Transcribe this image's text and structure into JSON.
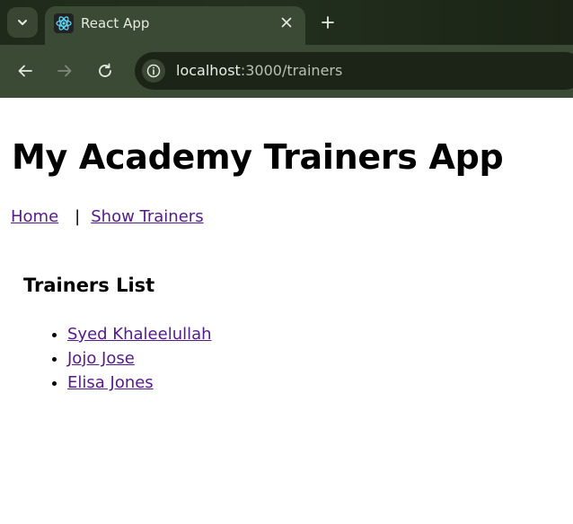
{
  "browser": {
    "tab_title": "React App",
    "url_host": "localhost",
    "url_path": ":3000/trainers",
    "colors": {
      "chrome_bg": "#1f2a1a",
      "tab_bg": "#3b4a34",
      "omnibox_bg": "#1c2418"
    },
    "icons": [
      "tab-search-icon",
      "react-favicon",
      "close-icon",
      "plus-icon",
      "back-arrow-icon",
      "forward-arrow-icon",
      "reload-icon",
      "site-info-icon"
    ]
  },
  "page": {
    "title": "My Academy Trainers App",
    "nav": {
      "home": "Home",
      "separator": "|",
      "show_trainers": "Show Trainers"
    },
    "section_title": "Trainers List",
    "trainers": [
      "Syed Khaleelullah",
      "Jojo Jose",
      "Elisa Jones"
    ],
    "colors": {
      "visited_link": "#551a8b"
    }
  }
}
